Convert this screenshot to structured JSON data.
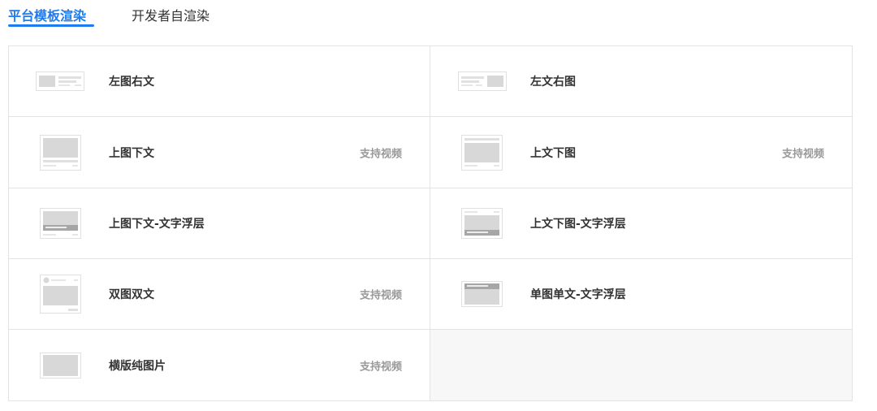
{
  "tabs": [
    {
      "label": "平台模板渲染",
      "active": true
    },
    {
      "label": "开发者自渲染",
      "active": false
    }
  ],
  "colors": {
    "accent": "#1f7cf0",
    "border": "#e3e3e3",
    "placeholder": "#d8d8d8",
    "muted": "#999999"
  },
  "templates": [
    {
      "label": "左图右文",
      "badge": "",
      "icon": "left-image-right-text-icon"
    },
    {
      "label": "左文右图",
      "badge": "",
      "icon": "left-text-right-image-icon"
    },
    {
      "label": "上图下文",
      "badge": "支持视频",
      "icon": "top-image-bottom-text-icon"
    },
    {
      "label": "上文下图",
      "badge": "支持视频",
      "icon": "top-text-bottom-image-icon"
    },
    {
      "label": "上图下文-文字浮层",
      "badge": "",
      "icon": "top-image-text-overlay-icon"
    },
    {
      "label": "上文下图-文字浮层",
      "badge": "",
      "icon": "top-text-image-overlay-icon"
    },
    {
      "label": "双图双文",
      "badge": "支持视频",
      "icon": "double-image-double-text-icon"
    },
    {
      "label": "单图单文-文字浮层",
      "badge": "",
      "icon": "single-image-text-overlay-icon"
    },
    {
      "label": "横版纯图片",
      "badge": "支持视频",
      "icon": "landscape-image-icon"
    }
  ]
}
